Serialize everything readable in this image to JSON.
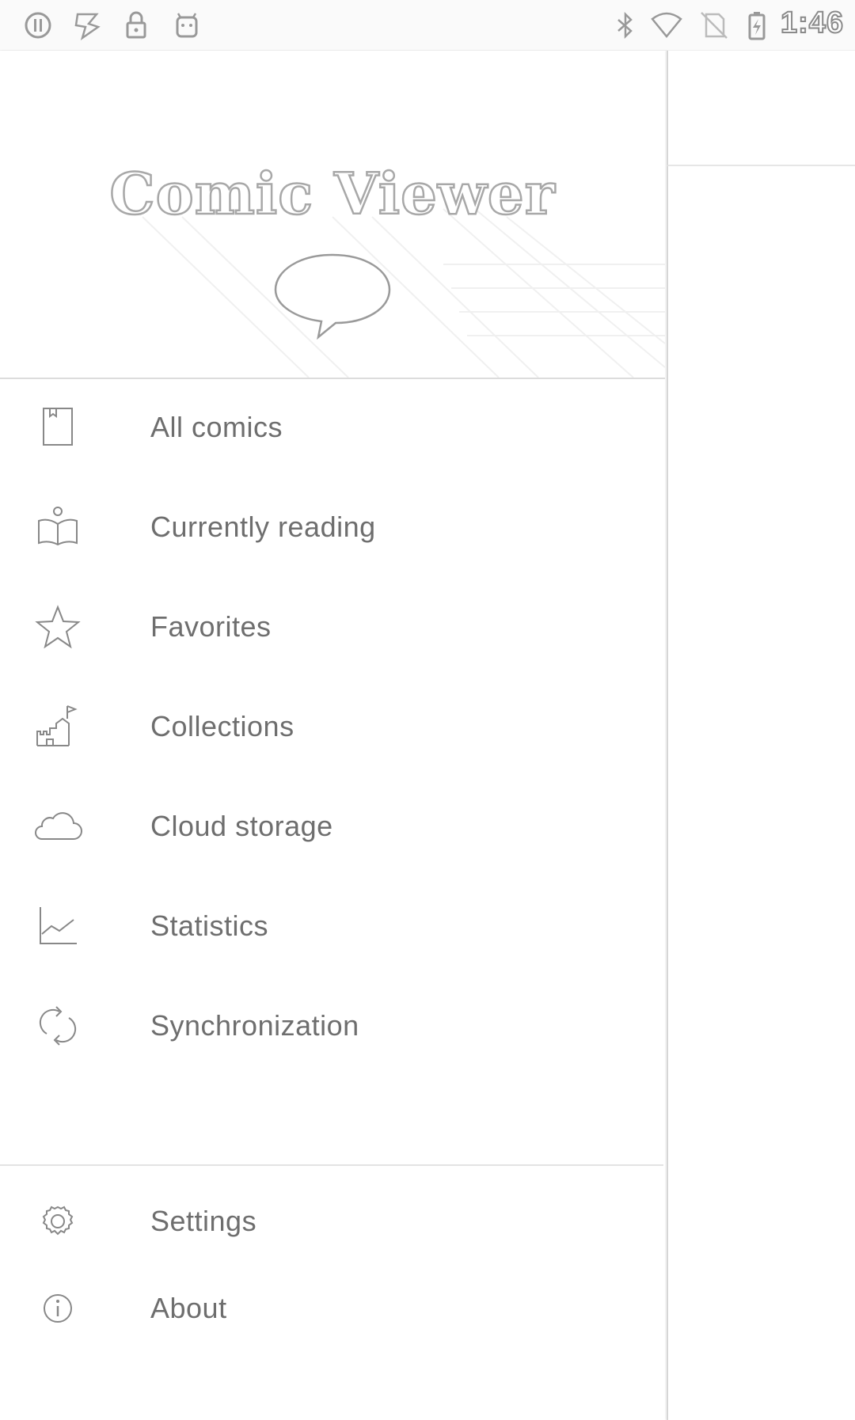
{
  "status_bar": {
    "time": "1:46",
    "left_icons": [
      "circle-signal-icon",
      "pokemon-go-icon",
      "lock-icon",
      "android-icon"
    ],
    "right_icons": [
      "bluetooth-icon",
      "wifi-icon",
      "no-sim-icon",
      "battery-charging-icon"
    ]
  },
  "header": {
    "title": "Comic Viewer",
    "logo_icon": "speech-bubble-icon"
  },
  "nav": {
    "items": [
      {
        "label": "All comics",
        "icon": "book-icon"
      },
      {
        "label": "Currently reading",
        "icon": "reading-icon"
      },
      {
        "label": "Favorites",
        "icon": "star-icon"
      },
      {
        "label": "Collections",
        "icon": "castle-icon"
      },
      {
        "label": "Cloud storage",
        "icon": "cloud-icon"
      },
      {
        "label": "Statistics",
        "icon": "chart-icon"
      },
      {
        "label": "Synchronization",
        "icon": "sync-icon"
      }
    ],
    "secondary": [
      {
        "label": "Settings",
        "icon": "gear-icon"
      },
      {
        "label": "About",
        "icon": "info-icon"
      }
    ]
  }
}
